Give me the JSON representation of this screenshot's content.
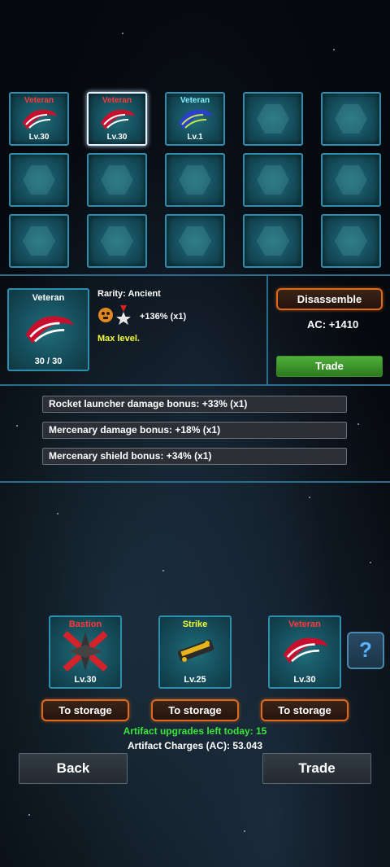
{
  "grid": {
    "slots": [
      {
        "name": "Veteran",
        "level": "Lv.30",
        "type": "veteran-red"
      },
      {
        "name": "Veteran",
        "level": "Lv.30",
        "type": "veteran-red",
        "selected": true
      },
      {
        "name": "Veteran",
        "level": "Lv.1",
        "type": "veteran-blue"
      }
    ]
  },
  "detail": {
    "card_name": "Veteran",
    "card_progress": "30 / 30",
    "rarity": "Rarity: Ancient",
    "bonus_summary": "+136% (x1)",
    "max_level": "Max level.",
    "disassemble_label": "Disassemble",
    "ac_value": "AC: +1410",
    "trade_label": "Trade"
  },
  "bonuses": [
    "Rocket launcher damage bonus: +33% (x1)",
    "Mercenary damage bonus: +18% (x1)",
    "Mercenary shield bonus: +34% (x1)"
  ],
  "equipped": [
    {
      "name": "Bastion",
      "level": "Lv.30",
      "button": "To storage"
    },
    {
      "name": "Strike",
      "level": "Lv.25",
      "button": "To storage"
    },
    {
      "name": "Veteran",
      "level": "Lv.30",
      "button": "To storage"
    }
  ],
  "help_label": "?",
  "upgrades_left": "Artifact upgrades left today: 15",
  "charges": "Artifact Charges (AC): 53.043",
  "nav": {
    "back": "Back",
    "trade": "Trade"
  },
  "colors": {
    "accent_border": "#2c8fb0",
    "orange": "#e06a1a",
    "green": "#4fb03a",
    "red_name": "#ff3b3b",
    "cyan_name": "#7ff0ff",
    "yellow_name": "#f4ff3b"
  }
}
